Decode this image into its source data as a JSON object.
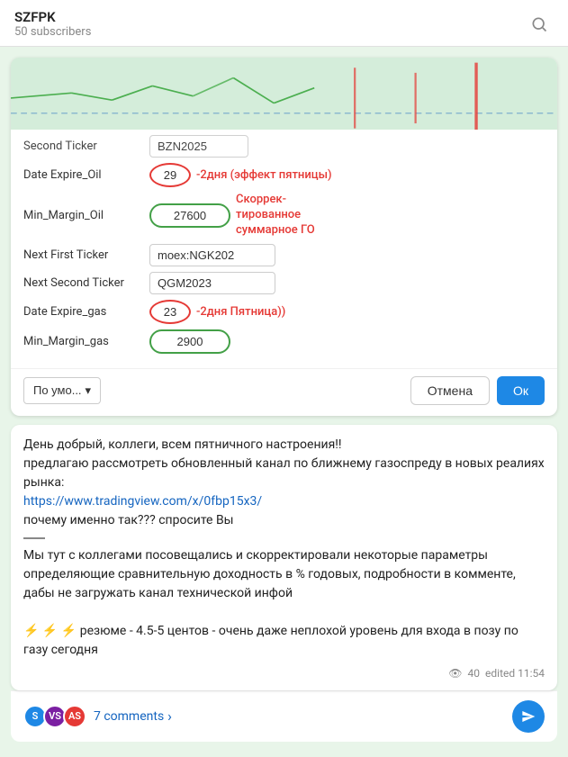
{
  "header": {
    "channel_name": "SZFPK",
    "subscribers": "50 subscribers",
    "search_label": "search"
  },
  "form": {
    "partial_label": "Second Ticker",
    "partial_value": "BZN2025",
    "rows": [
      {
        "id": "date_expire_oil",
        "label": "Date Expire_Oil",
        "value": "29",
        "style": "red",
        "annotation": "-2дня (эффект пятницы)"
      },
      {
        "id": "min_margin_oil",
        "label": "Min_Margin_Oil",
        "value": "27600",
        "style": "green",
        "annotation": "Скоррек-\nтированное\nсуммарное ГО"
      },
      {
        "id": "next_first_ticker",
        "label": "Next First Ticker",
        "value": "moex:NGK202",
        "style": "normal",
        "annotation": ""
      },
      {
        "id": "next_second_ticker",
        "label": "Next Second Ticker",
        "value": "QGM2023",
        "style": "normal",
        "annotation": ""
      },
      {
        "id": "date_expire_gas",
        "label": "Date Expire_gas",
        "value": "23",
        "style": "red",
        "annotation": "-2дня Пятница))"
      },
      {
        "id": "min_margin_gas",
        "label": "Min_Margin_gas",
        "value": "2900",
        "style": "green",
        "annotation": ""
      }
    ],
    "footer": {
      "dropdown_label": "По умо...",
      "cancel_label": "Отмена",
      "ok_label": "Ок"
    }
  },
  "message": {
    "text1": "День добрый, коллеги, всем пятничного настроения!!",
    "text2": "предлагаю рассмотреть обновленный канал по ближнему газоспреду в новых реалиях рынка:",
    "link": "https://www.tradingview.com/x/0fbp15x3/",
    "text3": "почему именно так??? спросите Вы",
    "text4": "Мы тут с коллегами посовещались и скорректировали некоторые параметры определяющие сравнительную доходность в % годовых, подробности в комменте, дабы не загружать канал технической инфой",
    "text5": "⚡ ⚡ ⚡ резюме - 4.5-5 центов - очень даже неплохой уровень для входа в позу по газу сегодня",
    "views": "40",
    "edited_time": "edited 11:54"
  },
  "comments": {
    "count_label": "7 comments",
    "avatars": [
      {
        "initial": "S",
        "color": "#1e88e5"
      },
      {
        "initial": "VS",
        "color": "#7b1fa2"
      },
      {
        "initial": "AS",
        "color": "#e53935"
      }
    ]
  }
}
